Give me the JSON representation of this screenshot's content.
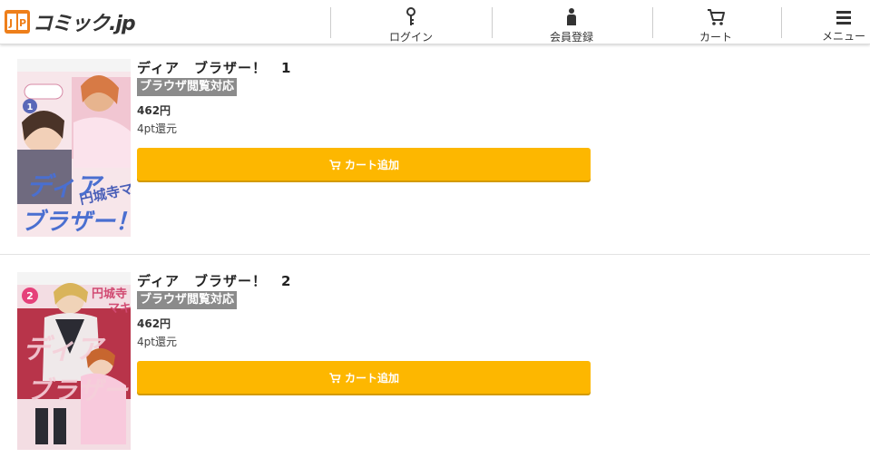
{
  "header": {
    "logo_text": "コミック.jp",
    "logo_badge": "JP",
    "nav": [
      {
        "label": "ログイン",
        "icon": "key-icon"
      },
      {
        "label": "会員登録",
        "icon": "person-icon"
      },
      {
        "label": "カート",
        "icon": "cart-icon"
      },
      {
        "label": "メニュー",
        "icon": "hamburger-menu-icon"
      }
    ]
  },
  "products": [
    {
      "title": "ディア　ブラザー！　1",
      "badge": "ブラウザ閲覧対応",
      "price": "462円",
      "points": "4pt還元",
      "cart_label": "カート追加",
      "cover_number": "1",
      "cover_title": "ディア ブラザー！"
    },
    {
      "title": "ディア　ブラザー！　2",
      "badge": "ブラウザ閲覧対応",
      "price": "462円",
      "points": "4pt還元",
      "cart_label": "カート追加",
      "cover_number": "2",
      "cover_title": "ディア ブラザー！"
    }
  ],
  "colors": {
    "accent": "#fdb700",
    "badge_bg": "#8b8b8b",
    "logo": "#ee7f1a"
  }
}
